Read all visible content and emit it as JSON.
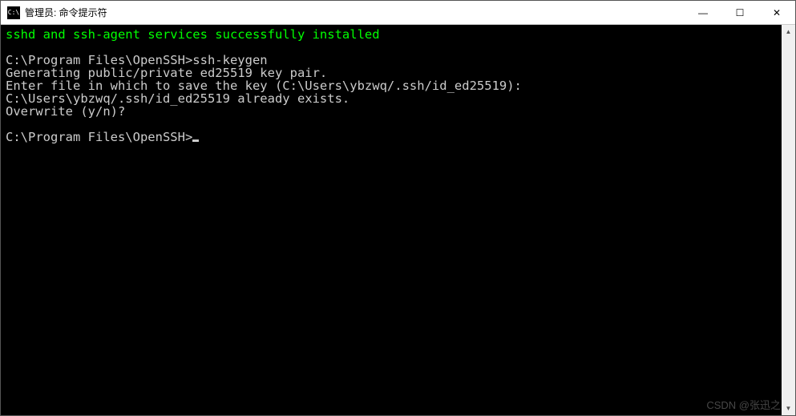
{
  "titlebar": {
    "icon_text": "C:\\",
    "title": "管理员: 命令提示符"
  },
  "controls": {
    "minimize": "—",
    "maximize": "☐",
    "close": "✕"
  },
  "console": {
    "success_line": "sshd and ssh-agent services successfully installed",
    "lines": [
      "",
      "C:\\Program Files\\OpenSSH>ssh-keygen",
      "Generating public/private ed25519 key pair.",
      "Enter file in which to save the key (C:\\Users\\ybzwq/.ssh/id_ed25519):",
      "C:\\Users\\ybzwq/.ssh/id_ed25519 already exists.",
      "Overwrite (y/n)?",
      "",
      "C:\\Program Files\\OpenSSH>"
    ]
  },
  "scrollbar": {
    "up": "▲",
    "down": "▼"
  },
  "watermark": "CSDN @张迅之"
}
